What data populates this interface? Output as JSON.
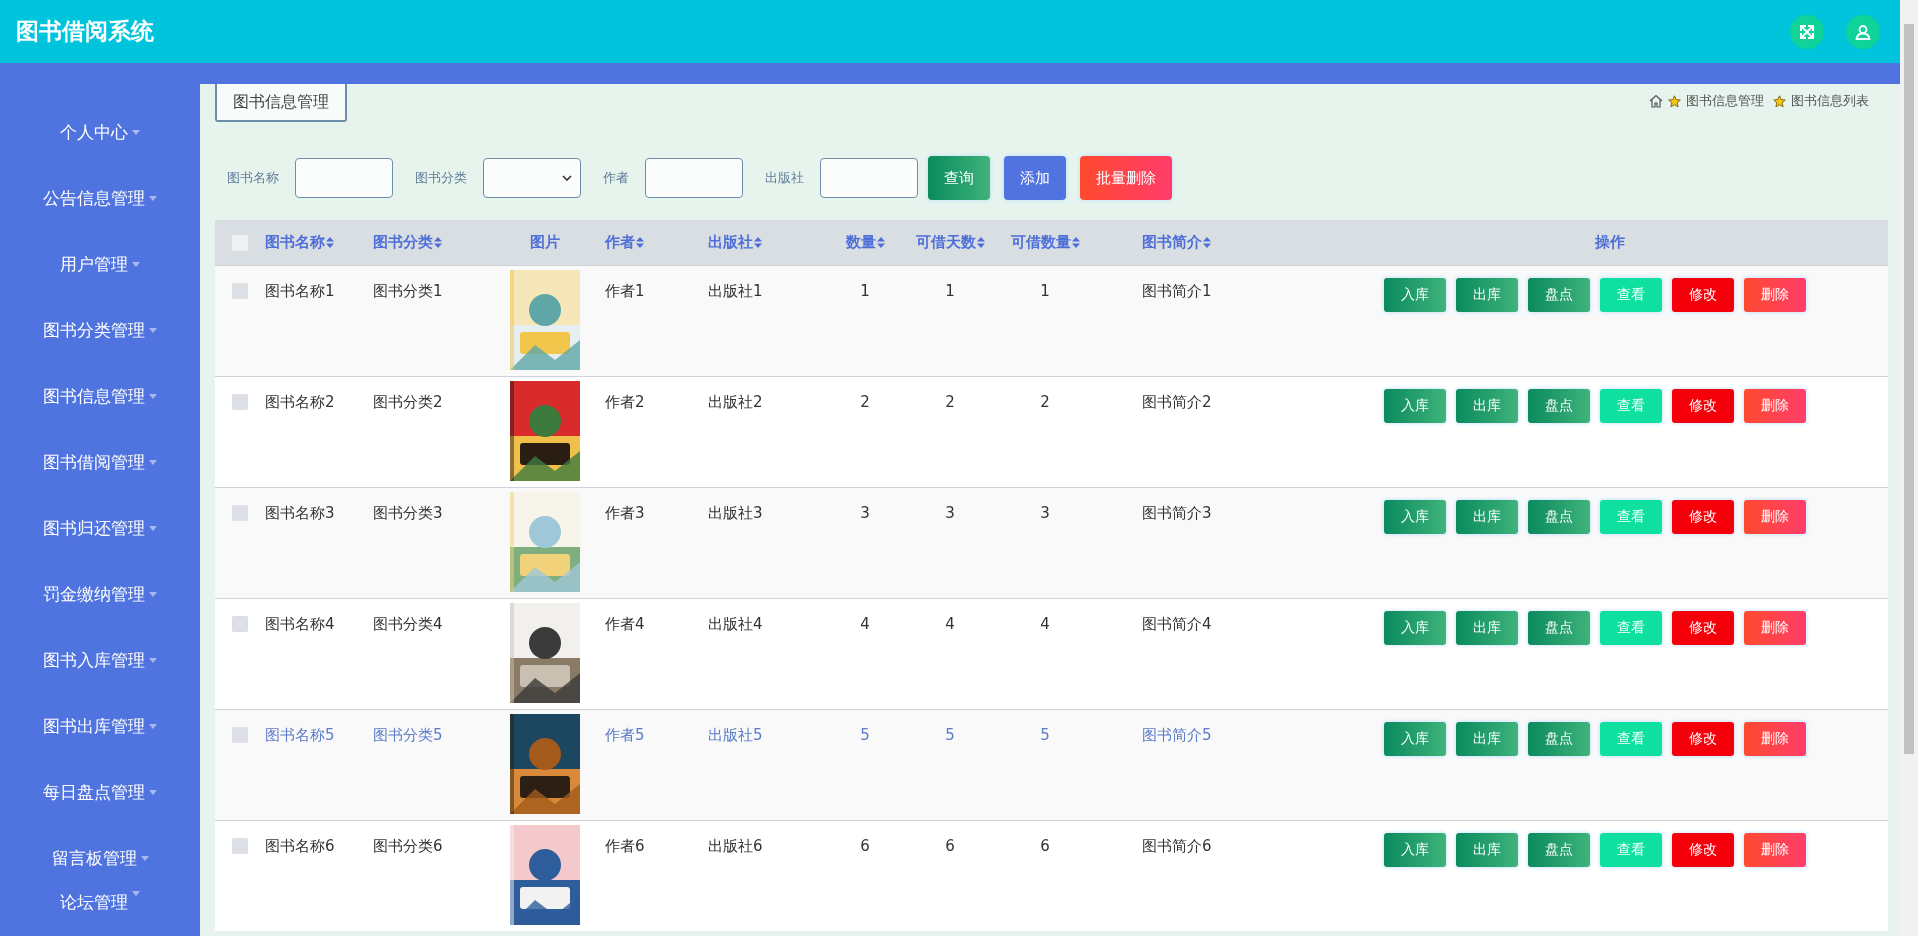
{
  "header": {
    "title": "图书借阅系统",
    "icons": [
      {
        "kind": "fullscreen"
      },
      {
        "kind": "user"
      }
    ]
  },
  "sidebar": {
    "items": [
      {
        "label": "个人中心"
      },
      {
        "label": "公告信息管理"
      },
      {
        "label": "用户管理"
      },
      {
        "label": "图书分类管理"
      },
      {
        "label": "图书信息管理"
      },
      {
        "label": "图书借阅管理"
      },
      {
        "label": "图书归还管理"
      },
      {
        "label": "罚金缴纳管理"
      },
      {
        "label": "图书入库管理"
      },
      {
        "label": "图书出库管理"
      },
      {
        "label": "每日盘点管理"
      },
      {
        "label": "留言板管理"
      },
      {
        "label": "论坛管理"
      }
    ]
  },
  "page_tab": "图书信息管理",
  "breadcrumb": [
    "图书信息管理",
    "图书信息列表"
  ],
  "filters": [
    {
      "label": "图书名称",
      "kind": "input"
    },
    {
      "label": "图书分类",
      "kind": "select"
    },
    {
      "label": "作者",
      "kind": "input"
    },
    {
      "label": "出版社",
      "kind": "input"
    }
  ],
  "filter_buttons": [
    {
      "label": "查询",
      "kind": "query"
    },
    {
      "label": "添加",
      "kind": "add"
    },
    {
      "label": "批量删除",
      "kind": "delete"
    }
  ],
  "table": {
    "select_all": {
      "checked": false
    },
    "columns": [
      {
        "label": "图书名称",
        "sortable": true
      },
      {
        "label": "图书分类",
        "sortable": true
      },
      {
        "label": "图片",
        "sortable": false
      },
      {
        "label": "作者",
        "sortable": true
      },
      {
        "label": "出版社",
        "sortable": true
      },
      {
        "label": "数量",
        "sortable": true
      },
      {
        "label": "可借天数",
        "sortable": true
      },
      {
        "label": "可借数量",
        "sortable": true
      },
      {
        "label": "图书简介",
        "sortable": true
      },
      {
        "label": "操作",
        "sortable": false
      }
    ],
    "rows": [
      {
        "checked": false,
        "hovered": false,
        "name": "图书名称1",
        "category": "图书分类1",
        "author": "作者1",
        "publisher": "出版社1",
        "quantity": "1",
        "loan_days": "1",
        "available": "1",
        "intro": "图书简介1",
        "actions": [
          {
            "label": "入库",
            "kind": "stock"
          },
          {
            "label": "出库",
            "kind": "stock"
          },
          {
            "label": "盘点",
            "kind": "stock"
          },
          {
            "label": "查看",
            "kind": "view"
          },
          {
            "label": "修改",
            "kind": "edit"
          },
          {
            "label": "删除",
            "kind": "delete"
          }
        ]
      },
      {
        "checked": false,
        "hovered": false,
        "name": "图书名称2",
        "category": "图书分类2",
        "author": "作者2",
        "publisher": "出版社2",
        "quantity": "2",
        "loan_days": "2",
        "available": "2",
        "intro": "图书简介2",
        "actions": [
          {
            "label": "入库",
            "kind": "stock"
          },
          {
            "label": "出库",
            "kind": "stock"
          },
          {
            "label": "盘点",
            "kind": "stock"
          },
          {
            "label": "查看",
            "kind": "view"
          },
          {
            "label": "修改",
            "kind": "edit"
          },
          {
            "label": "删除",
            "kind": "delete"
          }
        ]
      },
      {
        "checked": false,
        "hovered": false,
        "name": "图书名称3",
        "category": "图书分类3",
        "author": "作者3",
        "publisher": "出版社3",
        "quantity": "3",
        "loan_days": "3",
        "available": "3",
        "intro": "图书简介3",
        "actions": [
          {
            "label": "入库",
            "kind": "stock"
          },
          {
            "label": "出库",
            "kind": "stock"
          },
          {
            "label": "盘点",
            "kind": "stock"
          },
          {
            "label": "查看",
            "kind": "view"
          },
          {
            "label": "修改",
            "kind": "edit"
          },
          {
            "label": "删除",
            "kind": "delete"
          }
        ]
      },
      {
        "checked": false,
        "hovered": false,
        "name": "图书名称4",
        "category": "图书分类4",
        "author": "作者4",
        "publisher": "出版社4",
        "quantity": "4",
        "loan_days": "4",
        "available": "4",
        "intro": "图书简介4",
        "actions": [
          {
            "label": "入库",
            "kind": "stock"
          },
          {
            "label": "出库",
            "kind": "stock"
          },
          {
            "label": "盘点",
            "kind": "stock"
          },
          {
            "label": "查看",
            "kind": "view"
          },
          {
            "label": "修改",
            "kind": "edit"
          },
          {
            "label": "删除",
            "kind": "delete"
          }
        ]
      },
      {
        "checked": false,
        "hovered": true,
        "name": "图书名称5",
        "category": "图书分类5",
        "author": "作者5",
        "publisher": "出版社5",
        "quantity": "5",
        "loan_days": "5",
        "available": "5",
        "intro": "图书简介5",
        "actions": [
          {
            "label": "入库",
            "kind": "stock"
          },
          {
            "label": "出库",
            "kind": "stock"
          },
          {
            "label": "盘点",
            "kind": "stock"
          },
          {
            "label": "查看",
            "kind": "view"
          },
          {
            "label": "修改",
            "kind": "edit"
          },
          {
            "label": "删除",
            "kind": "delete"
          }
        ]
      },
      {
        "checked": false,
        "hovered": false,
        "name": "图书名称6",
        "category": "图书分类6",
        "author": "作者6",
        "publisher": "出版社6",
        "quantity": "6",
        "loan_days": "6",
        "available": "6",
        "intro": "图书简介6",
        "actions": [
          {
            "label": "入库",
            "kind": "stock"
          },
          {
            "label": "出库",
            "kind": "stock"
          },
          {
            "label": "盘点",
            "kind": "stock"
          },
          {
            "label": "查看",
            "kind": "view"
          },
          {
            "label": "修改",
            "kind": "edit"
          },
          {
            "label": "删除",
            "kind": "delete"
          }
        ]
      }
    ]
  }
}
